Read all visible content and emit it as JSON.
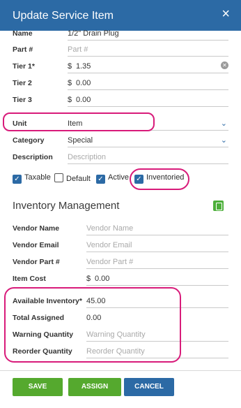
{
  "dialog": {
    "title": "Update Service Item",
    "close_icon": "×"
  },
  "fields": {
    "name": {
      "label": "Name",
      "value": "1/2\" Drain Plug"
    },
    "part": {
      "label": "Part #",
      "placeholder": "Part #"
    },
    "tier1": {
      "label": "Tier 1*",
      "currency": "$",
      "value": "1.35"
    },
    "tier2": {
      "label": "Tier 2",
      "currency": "$",
      "value": "0.00"
    },
    "tier3": {
      "label": "Tier 3",
      "currency": "$",
      "value": "0.00"
    },
    "unit": {
      "label": "Unit",
      "value": "Item"
    },
    "category": {
      "label": "Category",
      "value": "Special"
    },
    "description": {
      "label": "Description",
      "placeholder": "Description"
    }
  },
  "checkboxes": [
    {
      "label": "Taxable",
      "checked": true
    },
    {
      "label": "Default",
      "checked": false
    },
    {
      "label": "Active",
      "checked": true
    },
    {
      "label": "Inventoried",
      "checked": true
    }
  ],
  "inventory": {
    "title": "Inventory Management",
    "vendor_name": {
      "label": "Vendor Name",
      "placeholder": "Vendor Name"
    },
    "vendor_email": {
      "label": "Vendor Email",
      "placeholder": "Vendor Email"
    },
    "vendor_part": {
      "label": "Vendor Part #",
      "placeholder": "Vendor Part #"
    },
    "item_cost": {
      "label": "Item Cost",
      "currency": "$",
      "value": "0.00"
    },
    "available": {
      "label": "Available Inventory*",
      "value": "45.00"
    },
    "assigned": {
      "label": "Total Assigned",
      "value": "0.00"
    },
    "warning": {
      "label": "Warning Quantity",
      "placeholder": "Warning Quantity"
    },
    "reorder": {
      "label": "Reorder Quantity",
      "placeholder": "Reorder Quantity"
    }
  },
  "buttons": {
    "save": "SAVE",
    "assign": "ASSIGN",
    "cancel": "CANCEL"
  },
  "colors": {
    "header": "#2c6aa5",
    "green": "#55a92e",
    "highlight": "#d81b7a"
  }
}
